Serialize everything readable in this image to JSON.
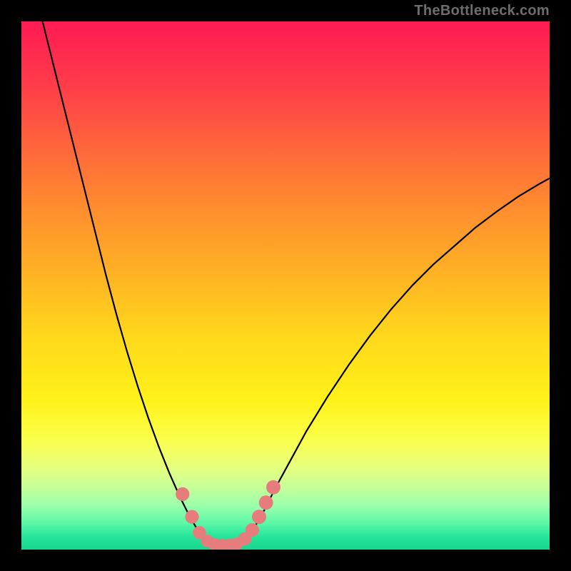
{
  "attribution": "TheBottleneck.com",
  "colors": {
    "background": "#000000",
    "marker": "#e77c7c",
    "curve": "#000000",
    "gradient_top": "#ff1a53",
    "gradient_bottom": "#18d68e"
  },
  "chart_data": {
    "type": "line",
    "title": "",
    "xlabel": "",
    "ylabel": "",
    "xlim": [
      0,
      100
    ],
    "ylim": [
      0,
      100
    ],
    "note": "Axes are unlabeled; x and y are normalized 0–100. Curve plotted from left series then right series.",
    "series": [
      {
        "name": "left-branch",
        "x": [
          4,
          6,
          8,
          10,
          12,
          14,
          16,
          18,
          20,
          22,
          24,
          26,
          28,
          30,
          32,
          33.5,
          35
        ],
        "y": [
          100,
          92,
          84,
          76,
          68,
          60,
          52,
          44.5,
          37.5,
          31,
          25,
          19.5,
          14.5,
          10,
          6,
          3.5,
          1.5
        ]
      },
      {
        "name": "valley-floor",
        "x": [
          35,
          36,
          37,
          38,
          39,
          40,
          41,
          42
        ],
        "y": [
          1.5,
          0.9,
          0.6,
          0.55,
          0.55,
          0.65,
          0.9,
          1.5
        ]
      },
      {
        "name": "right-branch",
        "x": [
          42,
          44,
          46,
          48,
          51,
          54,
          58,
          62,
          66,
          70,
          74,
          78,
          82,
          86,
          90,
          94,
          98,
          100
        ],
        "y": [
          1.5,
          4,
          7.5,
          11.5,
          17,
          22.5,
          29,
          35,
          40.5,
          45.5,
          50,
          54,
          57.5,
          61,
          64,
          66.8,
          69.2,
          70.3
        ]
      }
    ],
    "markers": {
      "name": "highlight-points",
      "points": [
        {
          "x": 30.5,
          "y": 10.5,
          "r": 1.3
        },
        {
          "x": 32.3,
          "y": 6.2,
          "r": 1.3
        },
        {
          "x": 33.7,
          "y": 3.2,
          "r": 1.25
        },
        {
          "x": 35.2,
          "y": 1.6,
          "r": 1.2
        },
        {
          "x": 36.6,
          "y": 0.95,
          "r": 1.2
        },
        {
          "x": 38.0,
          "y": 0.8,
          "r": 1.2
        },
        {
          "x": 39.4,
          "y": 0.85,
          "r": 1.2
        },
        {
          "x": 40.8,
          "y": 1.1,
          "r": 1.2
        },
        {
          "x": 42.3,
          "y": 2.0,
          "r": 1.25
        },
        {
          "x": 43.7,
          "y": 3.7,
          "r": 1.3
        },
        {
          "x": 45.0,
          "y": 6.2,
          "r": 1.35
        },
        {
          "x": 46.3,
          "y": 8.9,
          "r": 1.35
        },
        {
          "x": 47.7,
          "y": 11.8,
          "r": 1.35
        }
      ]
    }
  }
}
